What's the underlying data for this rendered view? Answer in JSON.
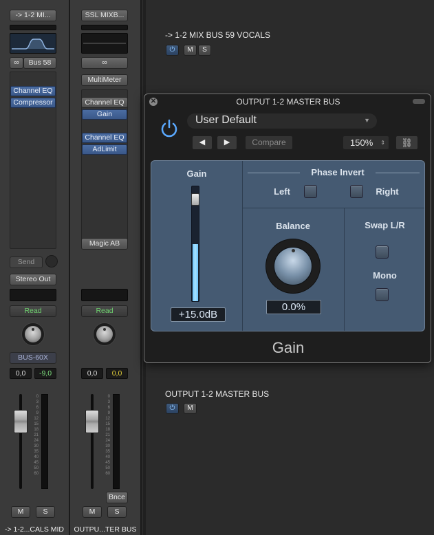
{
  "strip1": {
    "output_label": "-> 1-2 MI...",
    "bus_label": "Bus 58",
    "plugins": [
      "Channel EQ",
      "Compressor"
    ],
    "send_label": "Send",
    "output_select": "Stereo Out",
    "automation": "Read",
    "group_label": "BUS-60X",
    "volume": "0,0",
    "peak": "-9,0",
    "mute": "M",
    "solo": "S",
    "name": "-> 1-2...CALS MID"
  },
  "strip2": {
    "input_label": "SSL MIXB...",
    "inserts_top": [
      "MultiMeter"
    ],
    "inserts_a": [
      "Channel EQ",
      "Gain"
    ],
    "inserts_b": [
      "Channel EQ",
      "AdLimit"
    ],
    "bottom_insert": "Magic AB",
    "automation": "Read",
    "volume": "0,0",
    "peak": "0,0",
    "bounce": "Bnce",
    "mute": "M",
    "solo": "S",
    "name": "OUTPU...TER BUS"
  },
  "meter_scale": [
    "0",
    "3",
    "6",
    "9",
    "12",
    "15",
    "18",
    "21",
    "24",
    "30",
    "35",
    "40",
    "45",
    "50",
    "60"
  ],
  "track1": {
    "title": "-> 1-2 MIX BUS 59 VOCALS",
    "mute": "M",
    "solo": "S"
  },
  "track2": {
    "title": "OUTPUT 1-2 MASTER BUS",
    "mute": "M"
  },
  "plugin": {
    "window_title": "OUTPUT 1-2 MASTER BUS",
    "preset": "User Default",
    "compare": "Compare",
    "zoom": "150%",
    "gain_label": "Gain",
    "gain_value": "+15.0dB",
    "gain_level": 0.5,
    "phase_invert_label": "Phase Invert",
    "left_label": "Left",
    "right_label": "Right",
    "balance_label": "Balance",
    "balance_value": "0.0%",
    "swap_label": "Swap L/R",
    "mono_label": "Mono",
    "plugin_name": "Gain"
  },
  "colors": {
    "plugin_blue": "#455a72",
    "read_green": "#6fd36f",
    "peak_yellow": "#e6d23a",
    "peak_green": "#7ee07e",
    "accent_blue": "#5aa9ff"
  }
}
